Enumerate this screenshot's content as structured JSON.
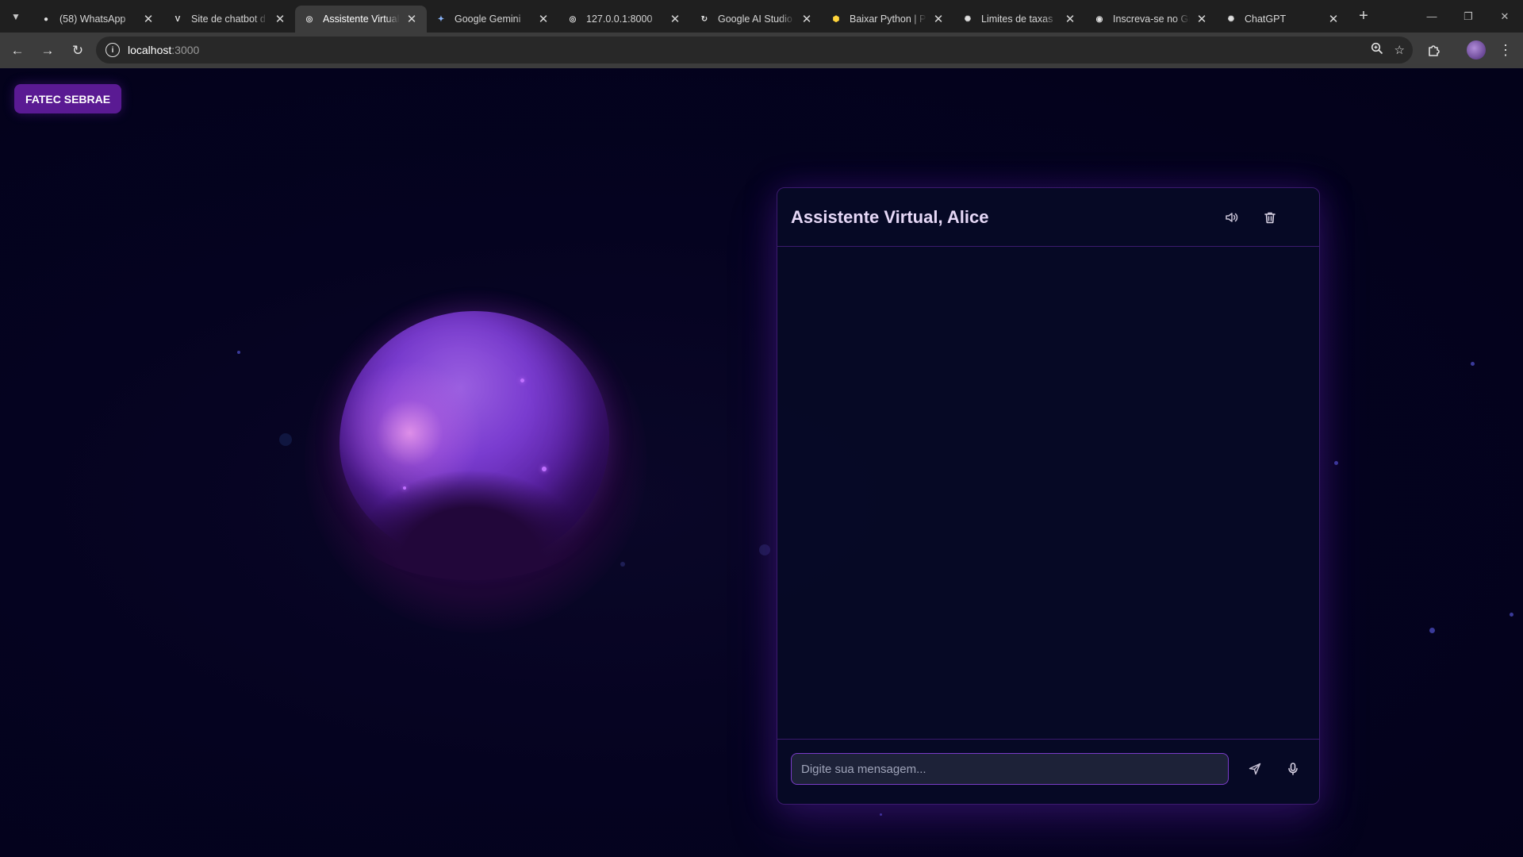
{
  "browser": {
    "tabs": [
      {
        "title": "(58) WhatsApp",
        "icon": "whatsapp-icon",
        "color": "#e0e0e0",
        "active": false
      },
      {
        "title": "Site de chatbot d",
        "icon": "vo-icon",
        "color": "#e0e0e0",
        "active": false
      },
      {
        "title": "Assistente Virtual",
        "icon": "globe-icon",
        "color": "#e0e0e0",
        "active": true
      },
      {
        "title": "Google Gemini",
        "icon": "gemini-icon",
        "color": "#8ab4f8",
        "active": false
      },
      {
        "title": "127.0.0.1:8000",
        "icon": "globe-icon",
        "color": "#e0e0e0",
        "active": false
      },
      {
        "title": "Google AI Studio",
        "icon": "reload-icon",
        "color": "#e0e0e0",
        "active": false
      },
      {
        "title": "Baixar Python | Py",
        "icon": "python-icon",
        "color": "#ffd43b",
        "active": false
      },
      {
        "title": "Limites de taxas",
        "icon": "openai-icon",
        "color": "#e0e0e0",
        "active": false
      },
      {
        "title": "Inscreva-se no Git",
        "icon": "github-icon",
        "color": "#e0e0e0",
        "active": false
      },
      {
        "title": "ChatGPT",
        "icon": "openai-icon",
        "color": "#e0e0e0",
        "active": false
      }
    ],
    "url_host": "localhost",
    "url_port": ":3000"
  },
  "page": {
    "brand": "FATEC SEBRAE"
  },
  "chat": {
    "title": "Assistente Virtual, Alice",
    "input_placeholder": "Digite sua mensagem...",
    "input_value": "",
    "messages": []
  },
  "colors": {
    "accent": "#7a3cc8",
    "brand_badge": "#5a1a93",
    "panel_border": "#3b1a6e",
    "page_background": "#04031a"
  }
}
